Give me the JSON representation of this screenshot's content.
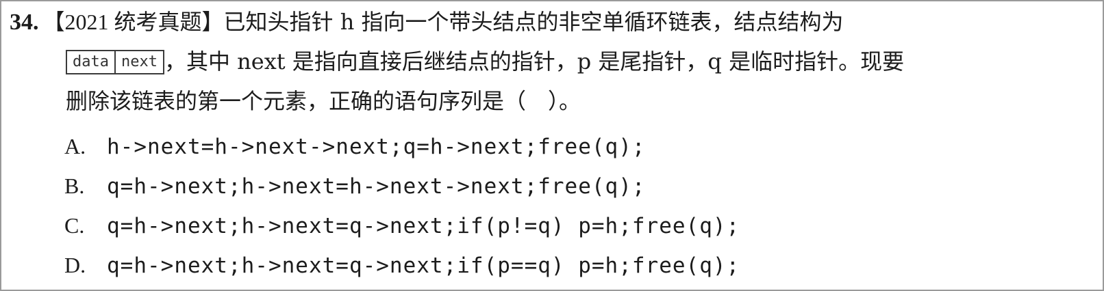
{
  "question": {
    "number": "34.",
    "source": "【2021 统考真题】",
    "line1_text": "已知头指针 h 指向一个带头结点的非空单循环链表，结点结构为",
    "node_fields": [
      "data",
      "next"
    ],
    "line2_text": "，其中 next 是指向直接后继结点的指针，p 是尾指针，q 是临时指针。现要",
    "line3_text": "删除该链表的第一个元素，正确的语句序列是（　）。"
  },
  "options": [
    {
      "label": "A.",
      "code": "h->next=h->next->next;q=h->next;free(q);"
    },
    {
      "label": "B.",
      "code": "q=h->next;h->next=h->next->next;free(q);"
    },
    {
      "label": "C.",
      "code": "q=h->next;h->next=q->next;if(p!=q) p=h;free(q);"
    },
    {
      "label": "D.",
      "code": "q=h->next;h->next=q->next;if(p==q) p=h;free(q);"
    }
  ]
}
